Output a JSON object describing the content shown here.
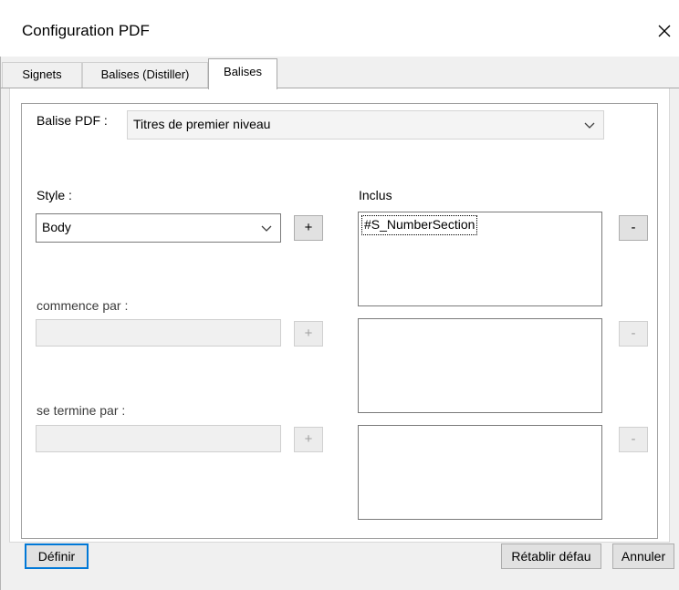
{
  "window": {
    "title": "Configuration PDF"
  },
  "tabs": [
    {
      "label": "Signets"
    },
    {
      "label": "Balises (Distiller)"
    },
    {
      "label": "Balises"
    }
  ],
  "balise": {
    "label": "Balise PDF :",
    "selected": "Titres de premier niveau"
  },
  "style": {
    "label": "Style :",
    "selected": "Body",
    "add_label": "+"
  },
  "inclus": {
    "label": "Inclus",
    "items": [
      "#S_NumberSection"
    ],
    "remove_label": "-"
  },
  "commence": {
    "label": "commence par :",
    "value": "",
    "add_label": "+",
    "remove_label": "-"
  },
  "termine": {
    "label": "se termine par :",
    "value": "",
    "add_label": "+",
    "remove_label": "-"
  },
  "footer": {
    "definir_label": "Définir",
    "retablir_label": "Rétablir défau",
    "annuler_label": "Annuler"
  },
  "colors": {
    "focus_border": "#0078d7",
    "dialog_bg": "#f0f0f0"
  }
}
